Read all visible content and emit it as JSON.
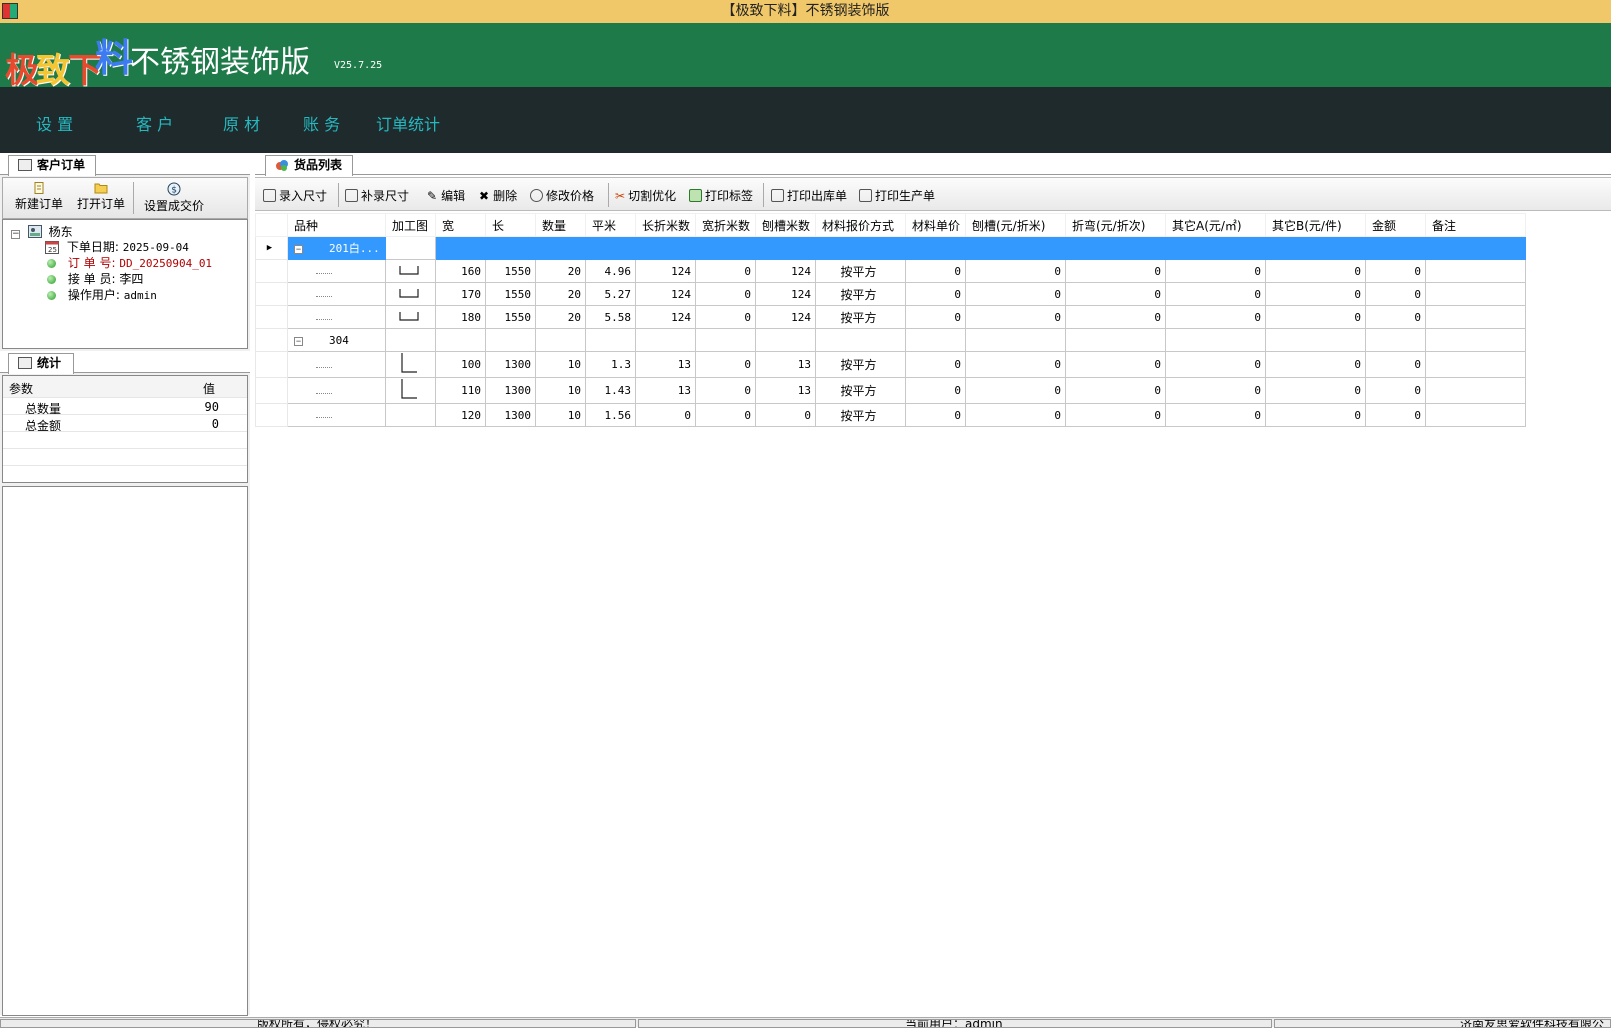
{
  "window": {
    "title": "【极致下料】不锈钢装饰版"
  },
  "header": {
    "logo_chars": [
      "极",
      "致",
      "下",
      "料"
    ],
    "app_name": "不锈钢装饰版",
    "version": "V25.7.25"
  },
  "menu": {
    "items": [
      {
        "label": "设  置"
      },
      {
        "label": "客  户"
      },
      {
        "label": "原  材"
      },
      {
        "label": "账  务"
      },
      {
        "label": "订单统计"
      }
    ]
  },
  "left": {
    "orders_tab": "客户订单",
    "toolbar": {
      "new_order": "新建订单",
      "open_order": "打开订单",
      "set_price": "设置成交价"
    },
    "tree": {
      "customer": "杨东",
      "order_date_label": "下单日期:",
      "order_date": "2025-09-04",
      "order_no_label": "订 单 号:",
      "order_no": "DD_20250904_01",
      "receiver_label": "接 单 员:",
      "receiver": "李四",
      "operator_label": "操作用户:",
      "operator": "admin"
    },
    "stats_tab": "统计",
    "stats": {
      "col_param": "参数",
      "col_value": "值",
      "rows": [
        {
          "name": "总数量",
          "value": "90"
        },
        {
          "name": "总金额",
          "value": "0"
        }
      ]
    }
  },
  "right": {
    "tab": "货品列表",
    "toolbar": {
      "enter_size": "录入尺寸",
      "supplement_size": "补录尺寸",
      "edit": "编辑",
      "delete": "删除",
      "modify_price": "修改价格",
      "cut_optimize": "切割优化",
      "print_label": "打印标签",
      "print_outbound": "打印出库单",
      "print_production": "打印生产单"
    },
    "grid": {
      "columns": [
        "品种",
        "加工图",
        "宽",
        "长",
        "数量",
        "平米",
        "长折米数",
        "宽折米数",
        "刨槽米数",
        "材料报价方式",
        "材料单价",
        "刨槽(元/折米)",
        "折弯(元/折次)",
        "其它A(元/㎡)",
        "其它B(元/件)",
        "金额",
        "备注"
      ],
      "groups": [
        {
          "name": "201白...",
          "rows": [
            {
              "shape": "channel",
              "w": "160",
              "l": "1550",
              "qty": "20",
              "sqm": "4.96",
              "lf": "124",
              "wf": "0",
              "groove": "124",
              "method": "按平方",
              "unit_price": "0",
              "groove_price": "0",
              "bend_price": "0",
              "other_a": "0",
              "other_b": "0",
              "amount": "0",
              "remark": ""
            },
            {
              "shape": "channel",
              "w": "170",
              "l": "1550",
              "qty": "20",
              "sqm": "5.27",
              "lf": "124",
              "wf": "0",
              "groove": "124",
              "method": "按平方",
              "unit_price": "0",
              "groove_price": "0",
              "bend_price": "0",
              "other_a": "0",
              "other_b": "0",
              "amount": "0",
              "remark": ""
            },
            {
              "shape": "channel",
              "w": "180",
              "l": "1550",
              "qty": "20",
              "sqm": "5.58",
              "lf": "124",
              "wf": "0",
              "groove": "124",
              "method": "按平方",
              "unit_price": "0",
              "groove_price": "0",
              "bend_price": "0",
              "other_a": "0",
              "other_b": "0",
              "amount": "0",
              "remark": ""
            }
          ]
        },
        {
          "name": "304",
          "rows": [
            {
              "shape": "angle",
              "w": "100",
              "l": "1300",
              "qty": "10",
              "sqm": "1.3",
              "lf": "13",
              "wf": "0",
              "groove": "13",
              "method": "按平方",
              "unit_price": "0",
              "groove_price": "0",
              "bend_price": "0",
              "other_a": "0",
              "other_b": "0",
              "amount": "0",
              "remark": ""
            },
            {
              "shape": "angle",
              "w": "110",
              "l": "1300",
              "qty": "10",
              "sqm": "1.43",
              "lf": "13",
              "wf": "0",
              "groove": "13",
              "method": "按平方",
              "unit_price": "0",
              "groove_price": "0",
              "bend_price": "0",
              "other_a": "0",
              "other_b": "0",
              "amount": "0",
              "remark": ""
            },
            {
              "shape": "none",
              "w": "120",
              "l": "1300",
              "qty": "10",
              "sqm": "1.56",
              "lf": "0",
              "wf": "0",
              "groove": "0",
              "method": "按平方",
              "unit_price": "0",
              "groove_price": "0",
              "bend_price": "0",
              "other_a": "0",
              "other_b": "0",
              "amount": "0",
              "remark": ""
            }
          ]
        }
      ]
    }
  },
  "status": {
    "copyright": "版权所有，侵权必究！",
    "current_user": "当前用户：admin",
    "company": "济南友思爱软件科技有限公司"
  },
  "colors": {
    "title_bar": "#f0c869",
    "header": "#1f7a49",
    "menu_bar": "#1e2a2c",
    "menu_text": "#26b8c0",
    "selection": "#3399ff"
  }
}
